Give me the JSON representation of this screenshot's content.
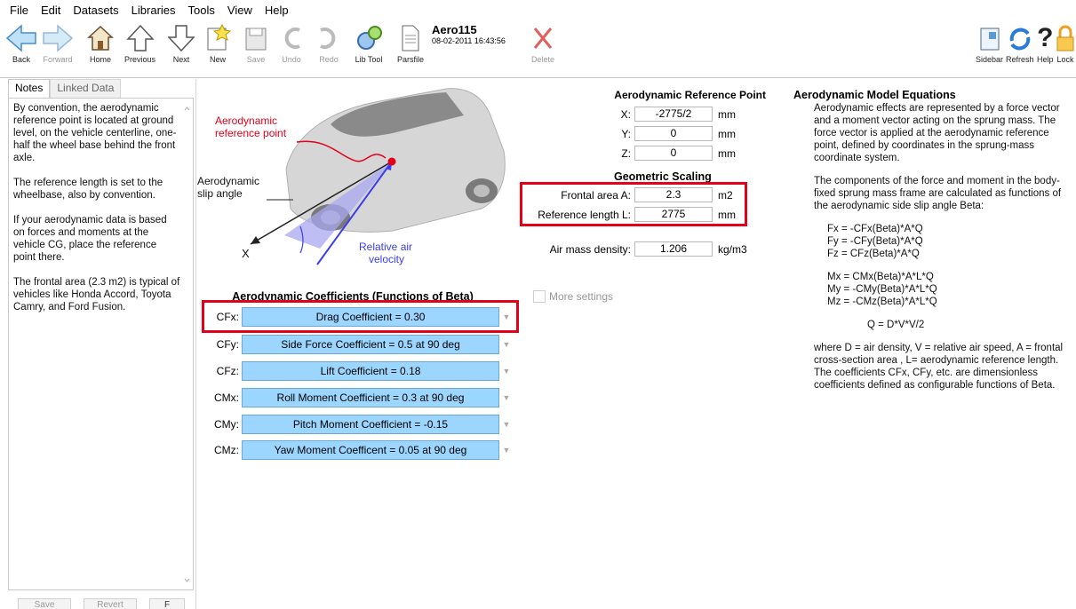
{
  "menu": [
    "File",
    "Edit",
    "Datasets",
    "Libraries",
    "Tools",
    "View",
    "Help"
  ],
  "toolbar": {
    "back": "Back",
    "forward": "Forward",
    "home": "Home",
    "previous": "Previous",
    "next": "Next",
    "new": "New",
    "save": "Save",
    "undo": "Undo",
    "redo": "Redo",
    "libtool": "Lib Tool",
    "parsfile": "Parsfile",
    "delete": "Delete",
    "sidebar": "Sidebar",
    "refresh": "Refresh",
    "help": "Help",
    "lock": "Lock"
  },
  "dataset": {
    "name": "Aero115",
    "date": "08-02-2011 16:43:56"
  },
  "tabs": {
    "notes": "Notes",
    "linked": "Linked Data"
  },
  "notes": [
    "By convention, the aerodynamic reference point is located at ground level, on the vehicle centerline, one-half the wheel base behind the front axle.",
    "The reference length is set to the wheelbase, also by convention.",
    "If your aerodynamic data is based on forces and moments at the vehicle CG, place the reference point there.",
    "The frontal area (2.3 m2) is typical of vehicles like Honda Accord, Toyota Camry, and Ford Fusion."
  ],
  "leftbuttons": {
    "save": "Save",
    "revert": "Revert",
    "f": "F"
  },
  "image": {
    "refpoint1": "Aerodynamic",
    "refpoint2": "reference point",
    "slip1": "Aerodynamic",
    "slip2": "slip angle",
    "air1": "Relative air",
    "air2": "velocity",
    "x": "X"
  },
  "refpoint": {
    "title": "Aerodynamic Reference Point",
    "x_label": "X:",
    "x": "-2775/2",
    "y_label": "Y:",
    "y": "0",
    "z_label": "Z:",
    "z": "0",
    "unit": "mm"
  },
  "scaling": {
    "title": "Geometric Scaling",
    "area_label": "Frontal area A:",
    "area": "2.3",
    "area_unit": "m2",
    "len_label": "Reference length  L:",
    "len": "2775",
    "len_unit": "mm",
    "dens_label": "Air mass density:",
    "dens": "1.206",
    "dens_unit": "kg/m3"
  },
  "coef": {
    "title": "Aerodynamic Coefficients (Functions of Beta)",
    "rows": [
      {
        "label": "CFx:",
        "value": "Drag Coefficient = 0.30"
      },
      {
        "label": "CFy:",
        "value": "Side Force Coefficient = 0.5 at 90 deg"
      },
      {
        "label": "CFz:",
        "value": "Lift Coefficient = 0.18"
      },
      {
        "label": "CMx:",
        "value": "Roll Moment Coefficient = 0.3 at 90 deg"
      },
      {
        "label": "CMy:",
        "value": "Pitch Moment Coefficient = -0.15"
      },
      {
        "label": "CMz:",
        "value": "Yaw Moment Coefficent = 0.05 at 90 deg"
      }
    ]
  },
  "more": "More settings",
  "equations": {
    "title": "Aerodynamic Model Equations",
    "p1": "Aerodynamic effects are represented by a force vector and a moment vector acting on the sprung mass. The force vector is applied at the aerodynamic reference point, defined by coordinates in the sprung-mass coordinate system.",
    "p2": "The components of the force and moment in the body-fixed sprung mass frame are calculated as functions of the aerodynamic side slip angle Beta:",
    "fx": "Fx = -CFx(Beta)*A*Q",
    "fy": "Fy = -CFy(Beta)*A*Q",
    "fz": "Fz =  CFz(Beta)*A*Q",
    "mx": "Mx =  CMx(Beta)*A*L*Q",
    "my": "My = -CMy(Beta)*A*L*Q",
    "mz": "Mz = -CMz(Beta)*A*L*Q",
    "q": "Q = D*V*V/2",
    "p3": "where D = air density, V = relative air speed, A = frontal cross-section area , L= aerodynamic reference length. The coefficients CFx, CFy, etc. are dimensionless coefficients defined as configurable functions of Beta."
  }
}
